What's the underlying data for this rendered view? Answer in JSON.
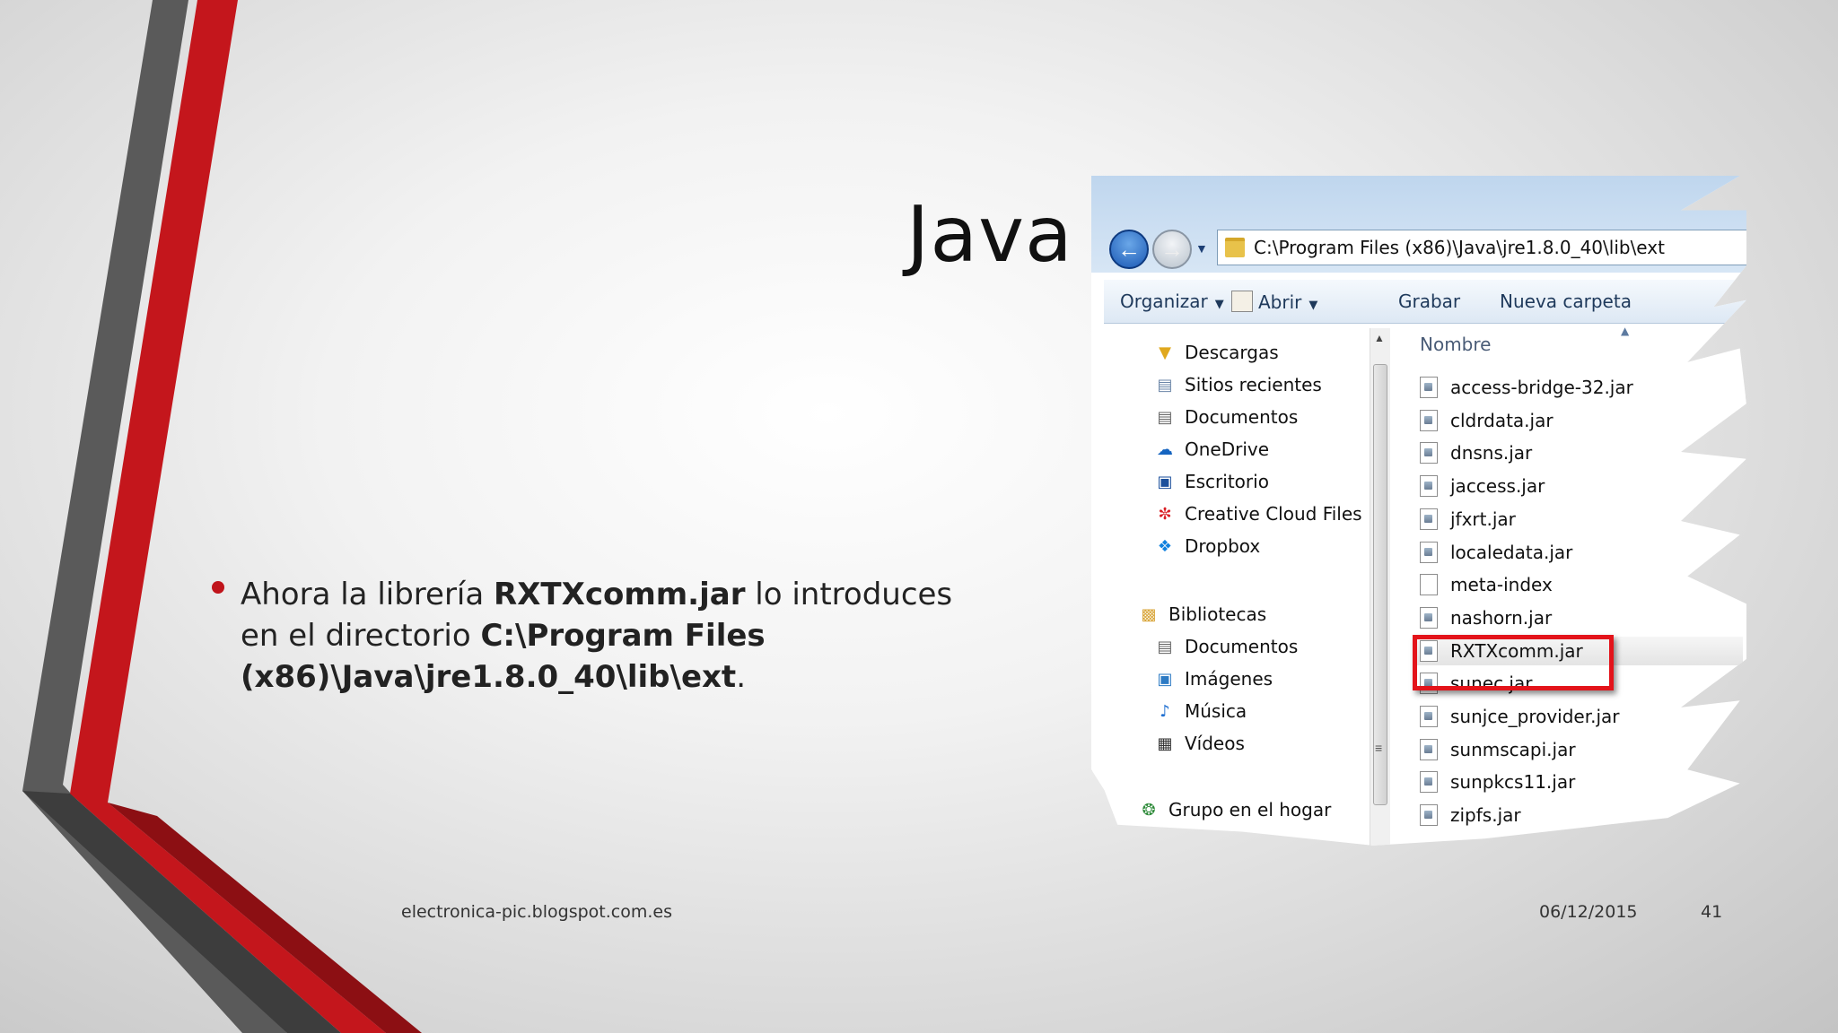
{
  "slide": {
    "title": "Java",
    "bullet": {
      "part1": "Ahora la librería ",
      "bold1": "RXTXcomm.jar",
      "part2": " lo introduces en el directorio ",
      "bold2": "C:\\Program Files (x86)\\Java\\jre1.8.0_40\\lib\\ext",
      "part3": "."
    },
    "footer": {
      "site": "electronica-pic.blogspot.com.es",
      "date": "06/12/2015",
      "page": "41"
    },
    "accent_color": "#c0141b"
  },
  "explorer": {
    "address": "C:\\Program Files (x86)\\Java\\jre1.8.0_40\\lib\\ext",
    "toolbar": {
      "organize": "Organizar",
      "open": "Abrir",
      "burn": "Grabar",
      "new_folder": "Nueva carpeta"
    },
    "nav": {
      "favorites": [
        "Descargas",
        "Sitios recientes",
        "Documentos",
        "OneDrive",
        "Escritorio",
        "Creative Cloud Files",
        "Dropbox"
      ],
      "libraries_label": "Bibliotecas",
      "libraries": [
        "Documentos",
        "Imágenes",
        "Música",
        "Vídeos"
      ],
      "homegroup": "Grupo en el hogar"
    },
    "column_header": "Nombre",
    "files": [
      "access-bridge-32.jar",
      "cldrdata.jar",
      "dnsns.jar",
      "jaccess.jar",
      "jfxrt.jar",
      "localedata.jar",
      "meta-index",
      "nashorn.jar",
      "RXTXcomm.jar",
      "sunec.jar",
      "sunjce_provider.jar",
      "sunmscapi.jar",
      "sunpkcs11.jar",
      "zipfs.jar"
    ],
    "selected_file": "RXTXcomm.jar",
    "highlight_color": "#e3131a"
  }
}
